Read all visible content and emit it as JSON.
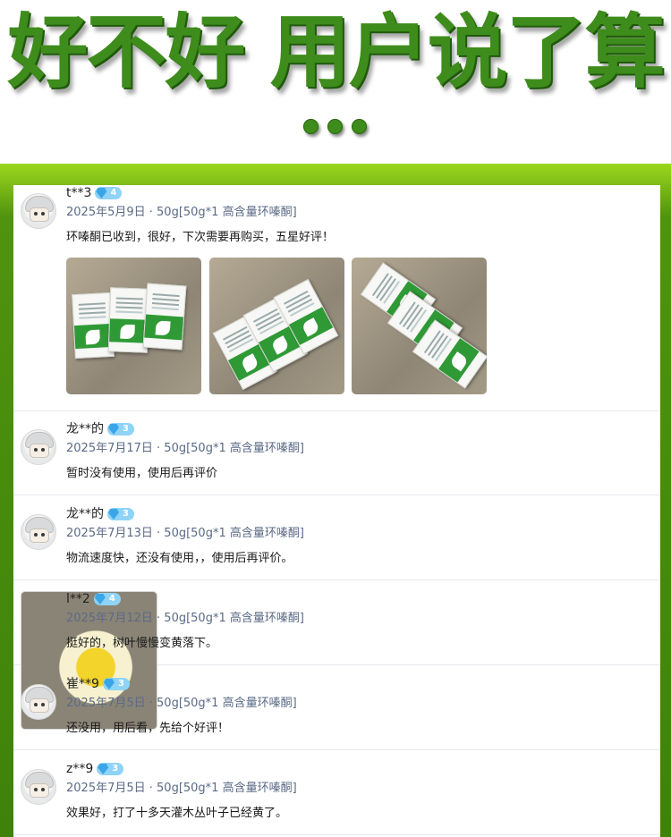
{
  "banner": {
    "headline": "好不好 用户说了算",
    "dots_count": 3
  },
  "colors": {
    "headline_green": "#3e8c1c",
    "frame_green": "#4f930e",
    "meta_text": "#5a6a86",
    "badge_blue": "#8fd3f6"
  },
  "reviews": [
    {
      "name": "t**3",
      "level": "4",
      "meta": "2025年5月9日 · 50g[50g*1 高含量环嗪酮]",
      "comment": "环嗪酮已收到，很好，下次需要再购买，五星好评！",
      "avatar": "default-avatar-icon",
      "photo_count": 3
    },
    {
      "name": "龙**的",
      "level": "3",
      "meta": "2025年7月17日 · 50g[50g*1 高含量环嗪酮]",
      "comment": "暂时没有使用，使用后再评价",
      "avatar": "default-avatar-icon"
    },
    {
      "name": "龙**的",
      "level": "3",
      "meta": "2025年7月13日 · 50g[50g*1 高含量环嗪酮]",
      "comment": "物流速度快，还没有使用，，使用后再评价。",
      "avatar": "default-avatar-icon"
    },
    {
      "name": "l**2",
      "level": "4",
      "meta": "2025年7月12日 · 50g[50g*1 高含量环嗪酮]",
      "comment": "挺好的，树叶慢慢变黄落下。",
      "avatar": "flower-photo-avatar"
    },
    {
      "name": "崔**9",
      "level": "3",
      "meta": "2025年7月5日 · 50g[50g*1 高含量环嗪酮]",
      "comment": "还没用，用后看，先给个好评！",
      "avatar": "default-avatar-icon"
    },
    {
      "name": "z**9",
      "level": "3",
      "meta": "2025年7月5日 · 50g[50g*1 高含量环嗪酮]",
      "comment": "效果好，打了十多天灌木丛叶子已经黄了。",
      "avatar": "default-avatar-icon"
    }
  ]
}
